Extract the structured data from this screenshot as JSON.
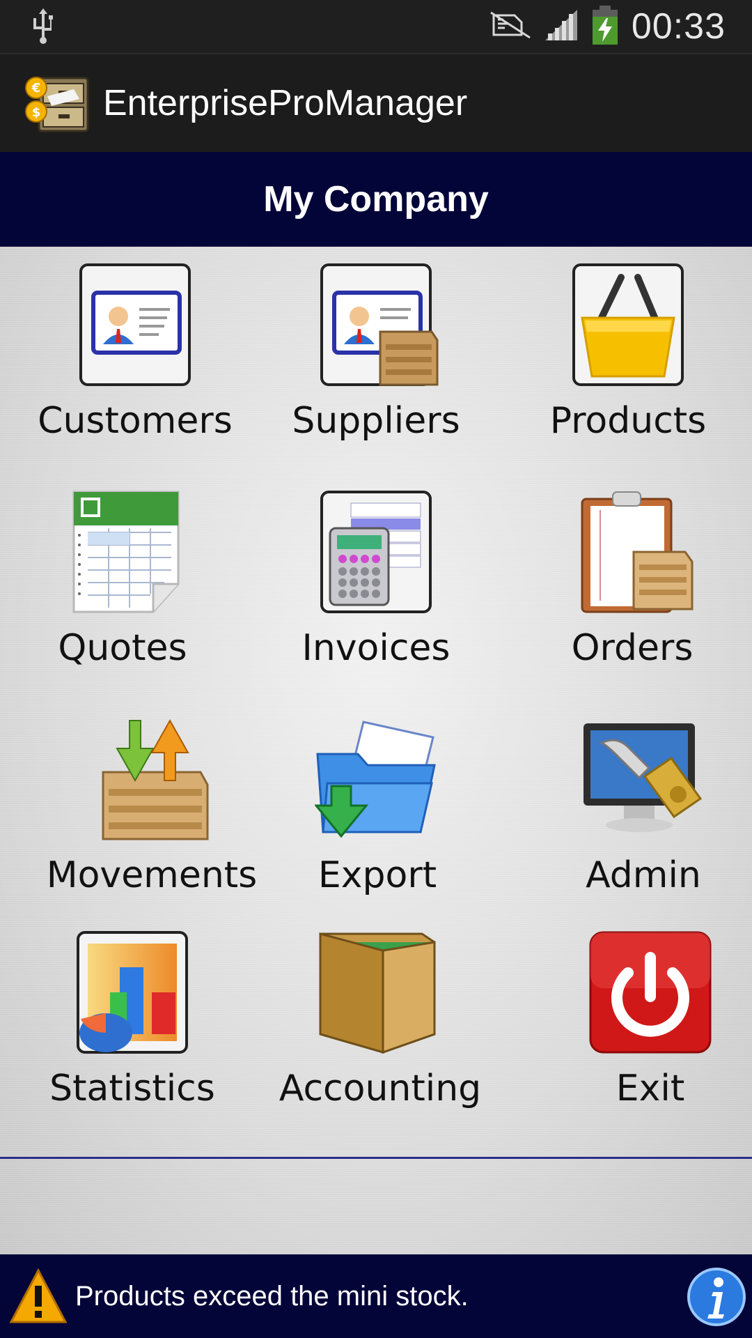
{
  "status": {
    "time": "00:33"
  },
  "app": {
    "title": "EnterpriseProManager"
  },
  "company": {
    "name": "My Company"
  },
  "menu": {
    "customers": "Customers",
    "suppliers": "Suppliers",
    "products": "Products",
    "quotes": "Quotes",
    "invoices": "Invoices",
    "orders": "Orders",
    "movements": "Movements",
    "export": "Export",
    "admin": "Admin",
    "statistics": "Statistics",
    "accounting": "Accounting",
    "exit": "Exit"
  },
  "footer": {
    "message": "Products exceed the mini stock."
  },
  "colors": {
    "banner": "#030438",
    "divider": "#2a2f8a",
    "statusbar": "#1f1f1f"
  },
  "icons": {
    "customers": "contact-card-icon",
    "suppliers": "contact-card-box-icon",
    "products": "basket-icon",
    "quotes": "spreadsheet-icon",
    "invoices": "calculator-icon",
    "orders": "clipboard-box-icon",
    "movements": "box-arrows-icon",
    "export": "folder-export-icon",
    "admin": "monitor-wrench-icon",
    "statistics": "chart-icon",
    "accounting": "wallet-icon",
    "exit": "power-icon"
  }
}
